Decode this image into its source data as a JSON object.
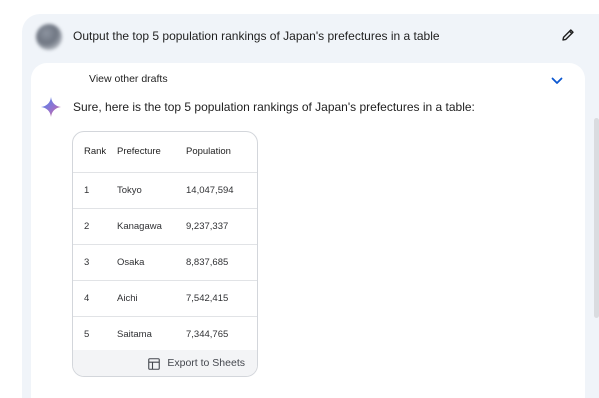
{
  "prompt": {
    "text": "Output the top 5 population rankings of Japan's prefectures in a table"
  },
  "response": {
    "drafts_label": "View other drafts",
    "intro": "Sure, here is the top 5 population rankings of Japan's prefectures in a table:",
    "table": {
      "headers": [
        "Rank",
        "Prefecture",
        "Population"
      ],
      "rows": [
        [
          "1",
          "Tokyo",
          "14,047,594"
        ],
        [
          "2",
          "Kanagawa",
          "9,237,337"
        ],
        [
          "3",
          "Osaka",
          "8,837,685"
        ],
        [
          "4",
          "Aichi",
          "7,542,415"
        ],
        [
          "5",
          "Saitama",
          "7,344,765"
        ]
      ]
    },
    "export_label": "Export to Sheets"
  },
  "icons": {
    "edit": "pencil-icon",
    "expand": "chevron-down-icon",
    "assistant": "sparkle-icon",
    "export": "sheets-icon"
  },
  "colors": {
    "background": "#f0f4f9",
    "accent_blue": "#0b57d0",
    "sparkle_blue": "#4285f4",
    "sparkle_pink": "#d96570"
  }
}
